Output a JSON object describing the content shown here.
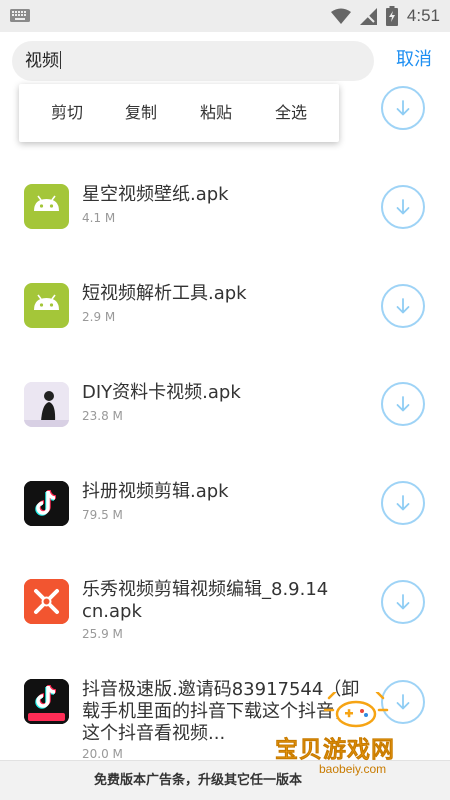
{
  "status_bar": {
    "time": "4:51"
  },
  "search": {
    "query": "视频",
    "cancel_label": "取消"
  },
  "context_menu": {
    "items": [
      "剪切",
      "复制",
      "粘贴",
      "全选"
    ]
  },
  "files": [
    {
      "name": "星空视频壁纸.apk",
      "size": "4.1 M",
      "icon": "android-icon"
    },
    {
      "name": "短视频解析工具.apk",
      "size": "2.9 M",
      "icon": "android-icon"
    },
    {
      "name": "DIY资料卡视频.apk",
      "size": "23.8 M",
      "icon": "photo-thumbnail"
    },
    {
      "name": "抖册视频剪辑.apk",
      "size": "79.5 M",
      "icon": "tiktok-icon"
    },
    {
      "name": "乐秀视频剪辑视频编辑_8.9.14cn.apk",
      "name_line1": "乐秀视频剪辑视频编辑_8.9.14",
      "name_line2": "cn.apk",
      "size": "25.9 M",
      "icon": "lexiu-icon"
    },
    {
      "name": "抖音极速版.邀请码83917544（卸载手机里面的抖音下载这个抖音，这个抖音看视频...",
      "name_line1": "抖音极速版.邀请码83917544（卸",
      "name_line2": "载手机里面的抖音下载这个抖音，",
      "name_line3": "这个抖音看视频...",
      "size": "20.0 M",
      "icon": "tiktok-lite-icon"
    }
  ],
  "ad_bar": {
    "text": "免费版本广告条，升级其它任一版本"
  },
  "watermark": {
    "title": "宝贝游戏网",
    "url": "baobeiy.com"
  },
  "colors": {
    "accent": "#1e8ff2",
    "download_ring": "#9ed3f6",
    "android_green": "#a4c639"
  }
}
